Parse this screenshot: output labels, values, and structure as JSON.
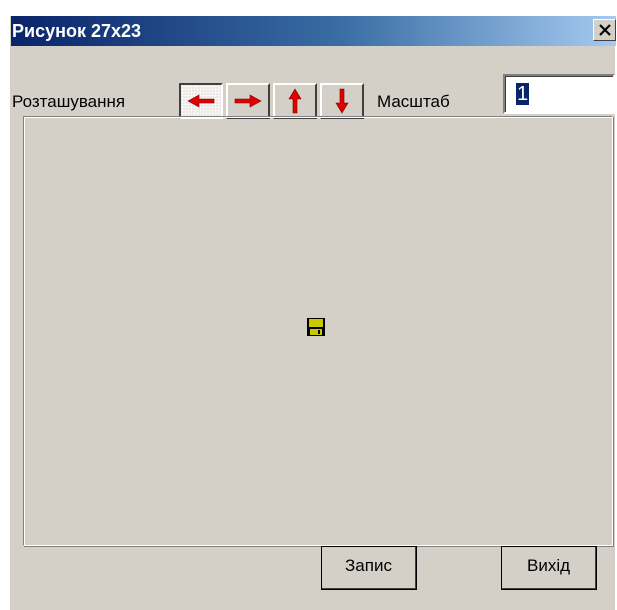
{
  "window": {
    "title": "Рисунок 27x23",
    "close_label": "×"
  },
  "toolbar": {
    "position_label": "Розташування",
    "scale_label": "Масштаб",
    "scale_value": "1",
    "arrow_buttons": [
      {
        "name": "left",
        "icon": "arrow-left-icon",
        "pressed": true
      },
      {
        "name": "right",
        "icon": "arrow-right-icon",
        "pressed": false
      },
      {
        "name": "up",
        "icon": "arrow-up-icon",
        "pressed": false
      },
      {
        "name": "down",
        "icon": "arrow-down-icon",
        "pressed": false
      }
    ]
  },
  "canvas": {
    "icon": "floppy-disk-icon"
  },
  "buttons": {
    "save_label": "Запис",
    "exit_label": "Вихід"
  },
  "colors": {
    "titlebar_start": "#0a246a",
    "titlebar_end": "#a6caf0",
    "face": "#d4d0c8",
    "arrow": "#e00000",
    "selection": "#0a246a"
  }
}
